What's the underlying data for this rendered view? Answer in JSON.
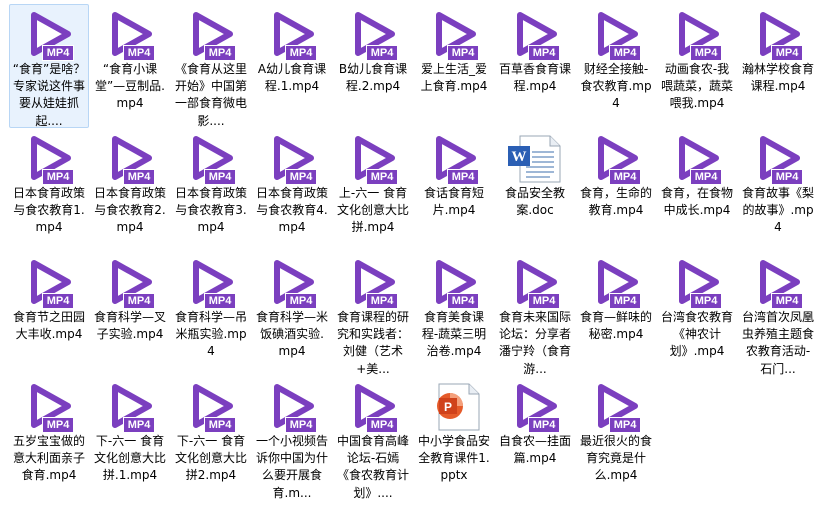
{
  "window": {
    "accent": "#7b3fbf"
  },
  "rows": [
    [
      {
        "name": "“食育”是啥？专家说这件事要从娃娃抓起....",
        "type": "mp4",
        "selected": true
      },
      {
        "name": "“食育小课堂”—豆制品.mp4",
        "type": "mp4"
      },
      {
        "name": "《食育从这里开始》中国第一部食育微电影....",
        "type": "mp4"
      },
      {
        "name": "A幼儿食育课程.1.mp4",
        "type": "mp4"
      },
      {
        "name": "B幼儿食育课程.2.mp4",
        "type": "mp4"
      },
      {
        "name": "爱上生活_爱上食育.mp4",
        "type": "mp4"
      },
      {
        "name": "百草香食育课程.mp4",
        "type": "mp4"
      },
      {
        "name": "财经全接触-食农教育.mp4",
        "type": "mp4"
      },
      {
        "name": "动画食农-我喂蔬菜，蔬菜喂我.mp4",
        "type": "mp4"
      },
      {
        "name": "瀚林学校食育课程.mp4",
        "type": "mp4"
      }
    ],
    [
      {
        "name": "日本食育政策与食农教育1.mp4",
        "type": "mp4"
      },
      {
        "name": "日本食育政策与食农教育2.mp4",
        "type": "mp4"
      },
      {
        "name": "日本食育政策与食农教育3.mp4",
        "type": "mp4"
      },
      {
        "name": "日本食育政策与食农教育4.mp4",
        "type": "mp4"
      },
      {
        "name": "上-六一 食育文化创意大比拼.mp4",
        "type": "mp4"
      },
      {
        "name": "食话食育短片.mp4",
        "type": "mp4"
      },
      {
        "name": "食品安全教案.doc",
        "type": "doc"
      },
      {
        "name": "食育，生命的教育.mp4",
        "type": "mp4"
      },
      {
        "name": "食育，在食物中成长.mp4",
        "type": "mp4"
      },
      {
        "name": "食育故事《梨的故事》.mp4",
        "type": "mp4"
      }
    ],
    [
      {
        "name": "食育节之田园大丰收.mp4",
        "type": "mp4"
      },
      {
        "name": "食育科学—叉子实验.mp4",
        "type": "mp4"
      },
      {
        "name": "食育科学—吊米瓶实验.mp4",
        "type": "mp4"
      },
      {
        "name": "食育科学—米饭碘酒实验.mp4",
        "type": "mp4"
      },
      {
        "name": "食育课程的研究和实践者：刘健（艺术+美...",
        "type": "mp4"
      },
      {
        "name": "食育美食课程-蔬菜三明治卷.mp4",
        "type": "mp4"
      },
      {
        "name": "食育未来国际论坛：分享者潘宁羚（食育游...",
        "type": "mp4"
      },
      {
        "name": "食育—鲜味的秘密.mp4",
        "type": "mp4"
      },
      {
        "name": "台湾食农教育《神农计划》.mp4",
        "type": "mp4"
      },
      {
        "name": "台湾首次凤凰虫养殖主题食农教育活动-石门...",
        "type": "mp4"
      }
    ],
    [
      {
        "name": "五岁宝宝做的意大利面亲子食育.mp4",
        "type": "mp4"
      },
      {
        "name": "下-六一 食育文化创意大比拼.1.mp4",
        "type": "mp4"
      },
      {
        "name": "下-六一 食育文化创意大比拼2.mp4",
        "type": "mp4"
      },
      {
        "name": "一个小视频告诉你中国为什么要开展食育.m...",
        "type": "mp4"
      },
      {
        "name": "中国食育高峰论坛-石嫣《食农教育计划》....",
        "type": "mp4"
      },
      {
        "name": "中小学食品安全教育课件1.pptx",
        "type": "pptx"
      },
      {
        "name": "自食农—挂面篇.mp4",
        "type": "mp4"
      },
      {
        "name": "最近很火的食育究竟是什么.mp4",
        "type": "mp4"
      }
    ]
  ],
  "badges": {
    "mp4": "MP4"
  },
  "icons": {
    "mp4": "play-icon",
    "doc": "word-document-icon",
    "pptx": "powerpoint-icon"
  }
}
